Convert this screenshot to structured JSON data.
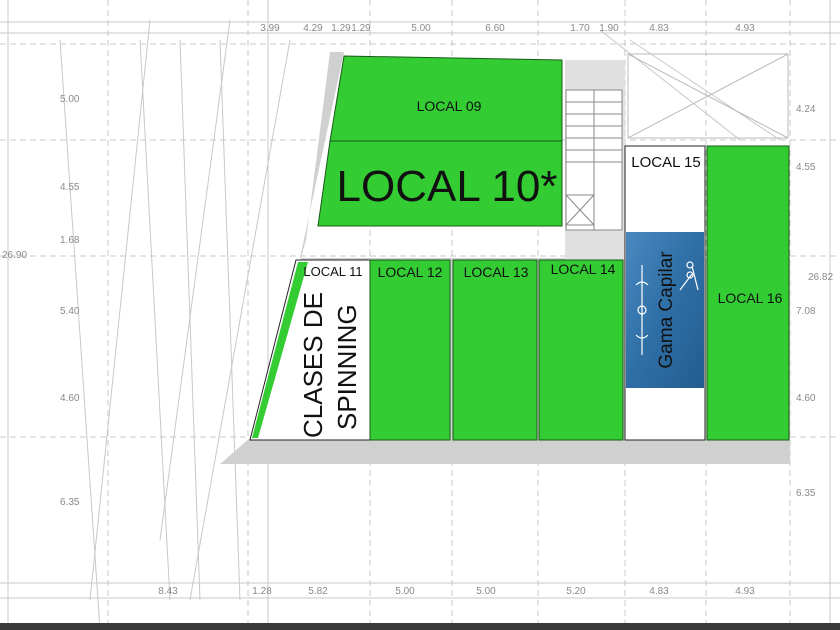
{
  "colors": {
    "unit_fill": "#33cc33",
    "corridor": "#d0d0d0",
    "grid": "#c4c4c4",
    "dim_text": "#8a8a8a",
    "banner": "#2e6fa6"
  },
  "units": {
    "local09": "LOCAL 09",
    "local10": "LOCAL 10*",
    "local11": "LOCAL 11",
    "local12": "LOCAL 12",
    "local13": "LOCAL 13",
    "local14": "LOCAL 14",
    "local15": "LOCAL 15",
    "local16": "LOCAL 16"
  },
  "spinning": {
    "line1": "CLASES DE",
    "line2": "SPINNING"
  },
  "banner": {
    "text": "Gama Capilar"
  },
  "dimensions": {
    "top": [
      "3.99",
      "4.29",
      "1.29",
      "1.29",
      "5.00",
      "6.60",
      "1.70",
      "1.90",
      "4.83",
      "4.93"
    ],
    "bottom": [
      "8.43",
      "1.28",
      "5.82",
      "5.00",
      "5.00",
      "5.20",
      "4.83",
      "4.93"
    ],
    "left": [
      "5.00",
      "4.55",
      "1.68",
      "5.40",
      "4.60",
      "6.35"
    ],
    "right": [
      "4.24",
      "4.55",
      "7.08",
      "4.60",
      "6.35"
    ],
    "left_total": "26.90",
    "right_total": "26.82"
  }
}
